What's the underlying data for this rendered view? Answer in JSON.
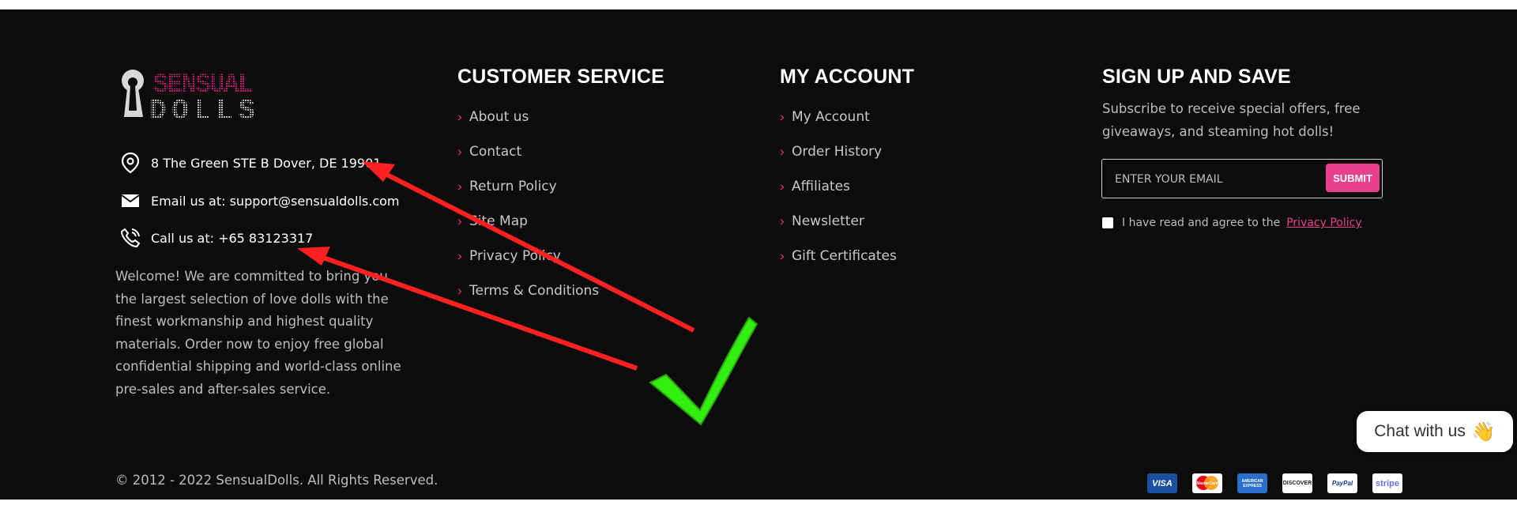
{
  "brand": {
    "logo_line1": "SENSUAL",
    "logo_line2": "DOLLS"
  },
  "contact": {
    "address": "8 The Green STE B Dover, DE 19901",
    "email": "Email us at: support@sensualdolls.com",
    "phone": "Call us at: +65 83123317",
    "icons": [
      "location-pin-icon",
      "mail-icon",
      "phone-icon"
    ]
  },
  "welcome": "Welcome! We are committed to bring you the largest selection of love dolls with the finest workmanship and highest quality materials. Order now to enjoy free global confidential shipping and world-class online pre-sales and after-sales service.",
  "customer_service": {
    "heading": "CUSTOMER SERVICE",
    "links": [
      "About us",
      "Contact",
      "Return Policy",
      "Site Map",
      "Privacy Policy",
      "Terms & Conditions"
    ]
  },
  "my_account": {
    "heading": "MY ACCOUNT",
    "links": [
      "My Account",
      "Order History",
      "Affiliates",
      "Newsletter",
      "Gift Certificates"
    ]
  },
  "signup": {
    "heading": "SIGN UP AND SAVE",
    "text": "Subscribe to receive special offers, free giveaways, and steaming hot dolls!",
    "email_placeholder": "ENTER YOUR EMAIL",
    "submit_label": "SUBMIT",
    "agree_text": "I have read and agree to the",
    "privacy_link": "Privacy Policy"
  },
  "copyright": "© 2012 - 2022 SensualDolls. All Rights Reserved.",
  "chat": {
    "label": "Chat with us",
    "emoji": "👋"
  },
  "payments": [
    "VISA",
    "MasterCard",
    "AMERICAN EXPRESS",
    "DISCOVER",
    "PayPal",
    "stripe"
  ],
  "colors": {
    "background": "#0c0c0c",
    "accent": "#e8408d",
    "chevron": "#e8336b",
    "annotation_arrow": "#ff2020",
    "annotation_check": "#33ee11"
  }
}
